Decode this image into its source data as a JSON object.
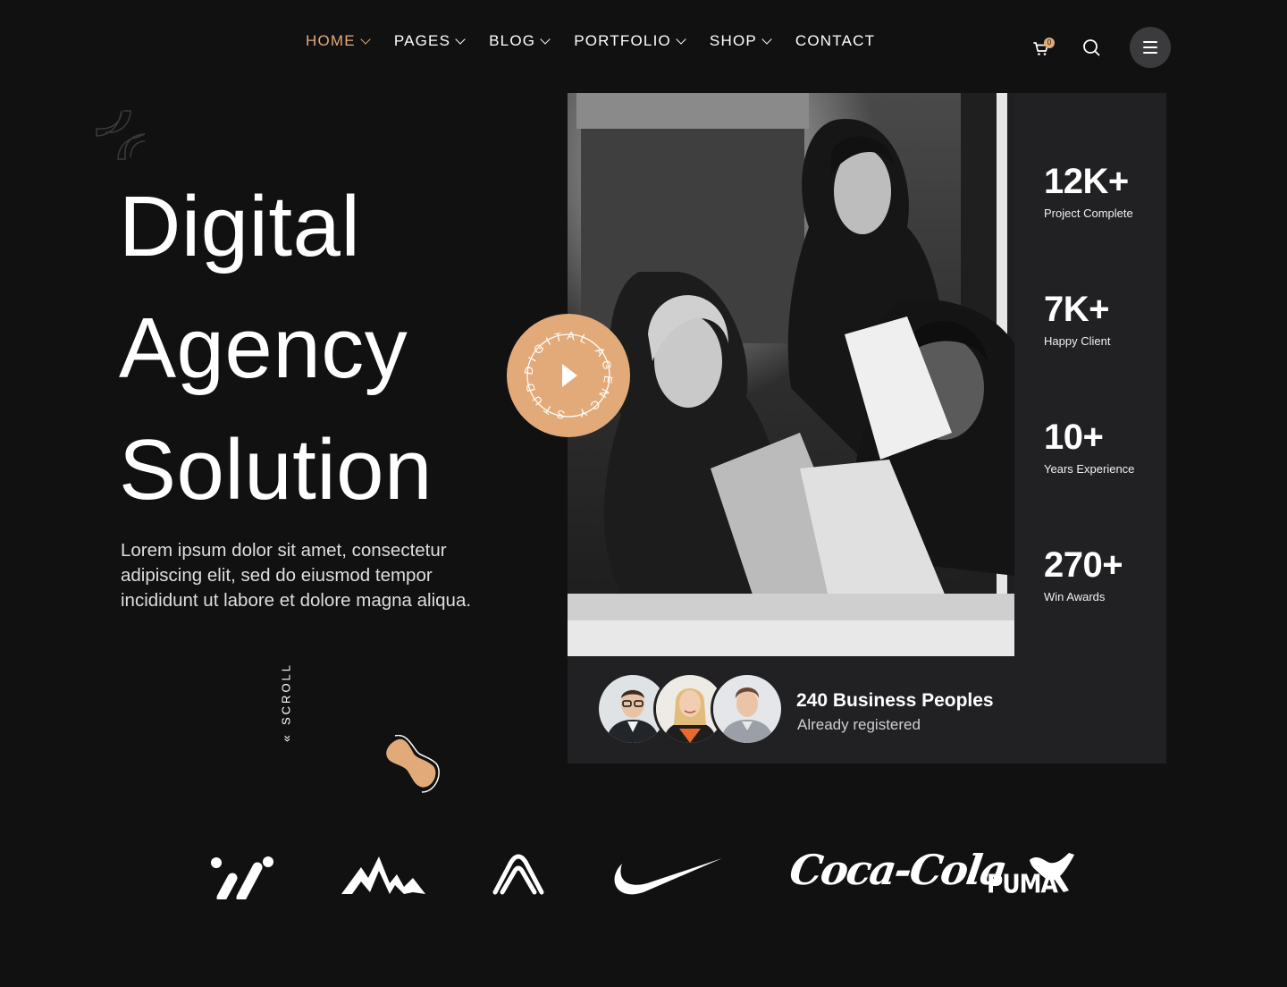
{
  "nav": {
    "items": [
      {
        "label": "HOME",
        "active": true,
        "dropdown": true
      },
      {
        "label": "PAGES",
        "active": false,
        "dropdown": true
      },
      {
        "label": "BLOG",
        "active": false,
        "dropdown": true
      },
      {
        "label": "PORTFOLIO",
        "active": false,
        "dropdown": true
      },
      {
        "label": "SHOP",
        "active": false,
        "dropdown": true
      },
      {
        "label": "CONTACT",
        "active": false,
        "dropdown": false
      }
    ],
    "cart_count": "0",
    "icons": {
      "cart": "cart-icon",
      "search": "search-icon",
      "menu": "hamburger-menu-icon"
    }
  },
  "hero": {
    "title_lines": [
      "Digital",
      "Agency",
      "Solution"
    ],
    "description": "Lorem ipsum dolor sit amet, consectetur adipiscing elit, sed do eiusmod tempor incididunt ut labore et dolore magna aliqua.",
    "scroll_label": "SCROLL"
  },
  "badge": {
    "circular_text": "DIGITAL AGENCY STUDIO",
    "icon": "play-icon"
  },
  "stats": [
    {
      "value": "12K+",
      "label": "Project Complete"
    },
    {
      "value": "7K+",
      "label": "Happy Client"
    },
    {
      "value": "10+",
      "label": "Years Experience"
    },
    {
      "value": "270+",
      "label": "Win Awards"
    }
  ],
  "registered": {
    "title": "240 Business Peoples",
    "subtitle": "Already registered"
  },
  "brands": {
    "coca_cola": "Coca-Cola",
    "puma": "PUMA"
  },
  "colors": {
    "background": "#121112",
    "accent": "#e2aa78",
    "panel": "#212022"
  }
}
